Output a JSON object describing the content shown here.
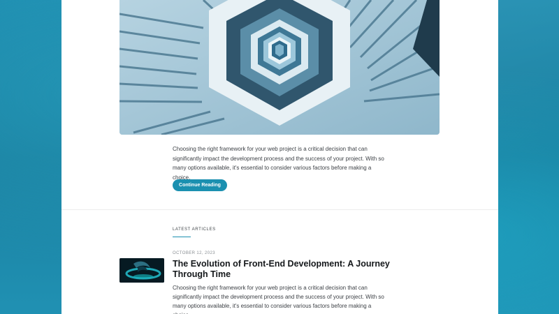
{
  "featured_post": {
    "excerpt": "Choosing the right framework for your web project is a critical decision that can significantly impact the development process and the success of your project. With so many options available, it's essential to consider various factors before making a choice.",
    "button_label": "Continue Reading"
  },
  "latest_articles": {
    "section_label": "LATEST ARTICLES",
    "items": [
      {
        "date": "OCTOBER 12, 2023",
        "title": "The Evolution of Front-End Development: A Journey Through Time",
        "excerpt": "Choosing the right framework for your web project is a critical decision that can significantly impact the development process and the success of your project. With so many options available, it's essential to consider various factors before making a choice."
      }
    ]
  },
  "colors": {
    "accent": "#1b90b0",
    "background": "#1d86a6",
    "text": "#3b3f44"
  }
}
